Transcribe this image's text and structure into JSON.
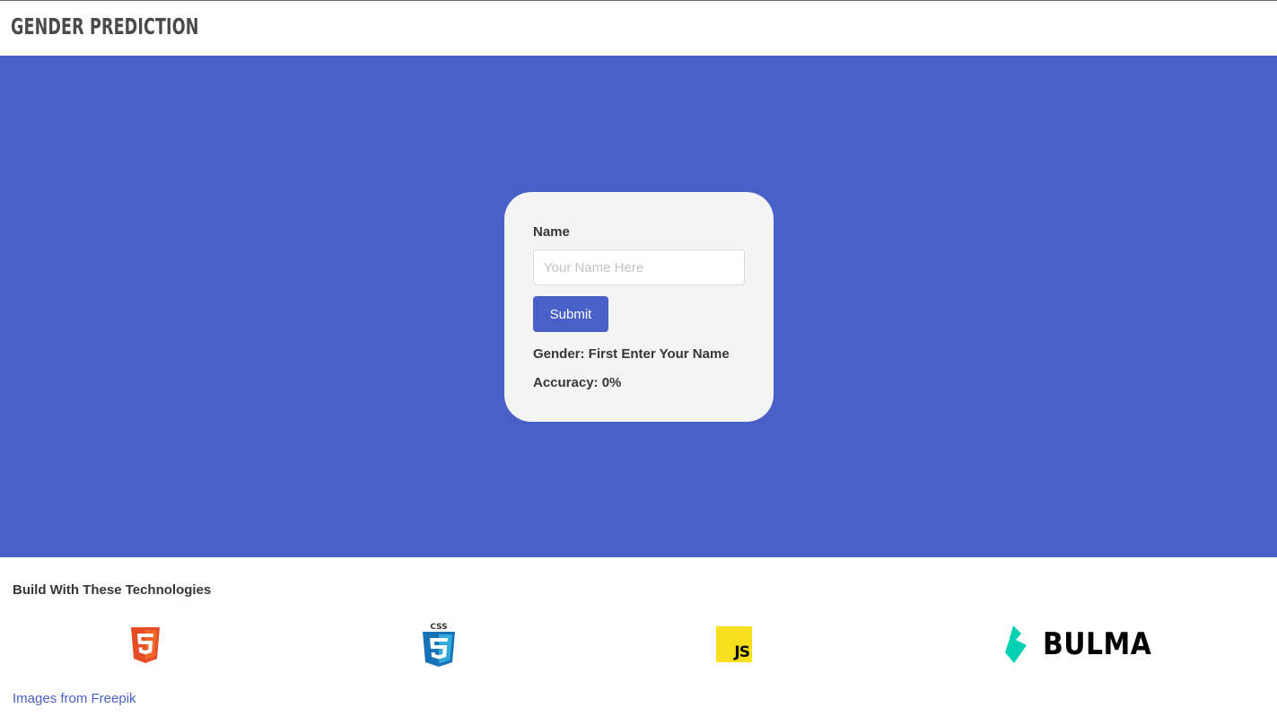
{
  "header": {
    "title": "GENDER PREDICTION"
  },
  "form": {
    "name_label": "Name",
    "name_placeholder": "Your Name Here",
    "name_value": "",
    "submit_label": "Submit",
    "gender_text": "Gender: First Enter Your Name",
    "accuracy_text": "Accuracy: 0%"
  },
  "footer": {
    "title": "Build With These Technologies",
    "technologies": [
      {
        "name": "HTML5",
        "icon": "html5-icon"
      },
      {
        "name": "CSS3",
        "icon": "css3-icon"
      },
      {
        "name": "JS",
        "icon": "javascript-icon"
      },
      {
        "name": "BULMA",
        "icon": "bulma-icon"
      }
    ],
    "credit_link": "Images from Freepik"
  },
  "colors": {
    "primary": "#4860c8",
    "card_background": "#f4f4f4",
    "html5_orange": "#e44d26",
    "css3_blue": "#1572b6",
    "js_yellow": "#f7df1e",
    "bulma_teal": "#00d1b2"
  }
}
